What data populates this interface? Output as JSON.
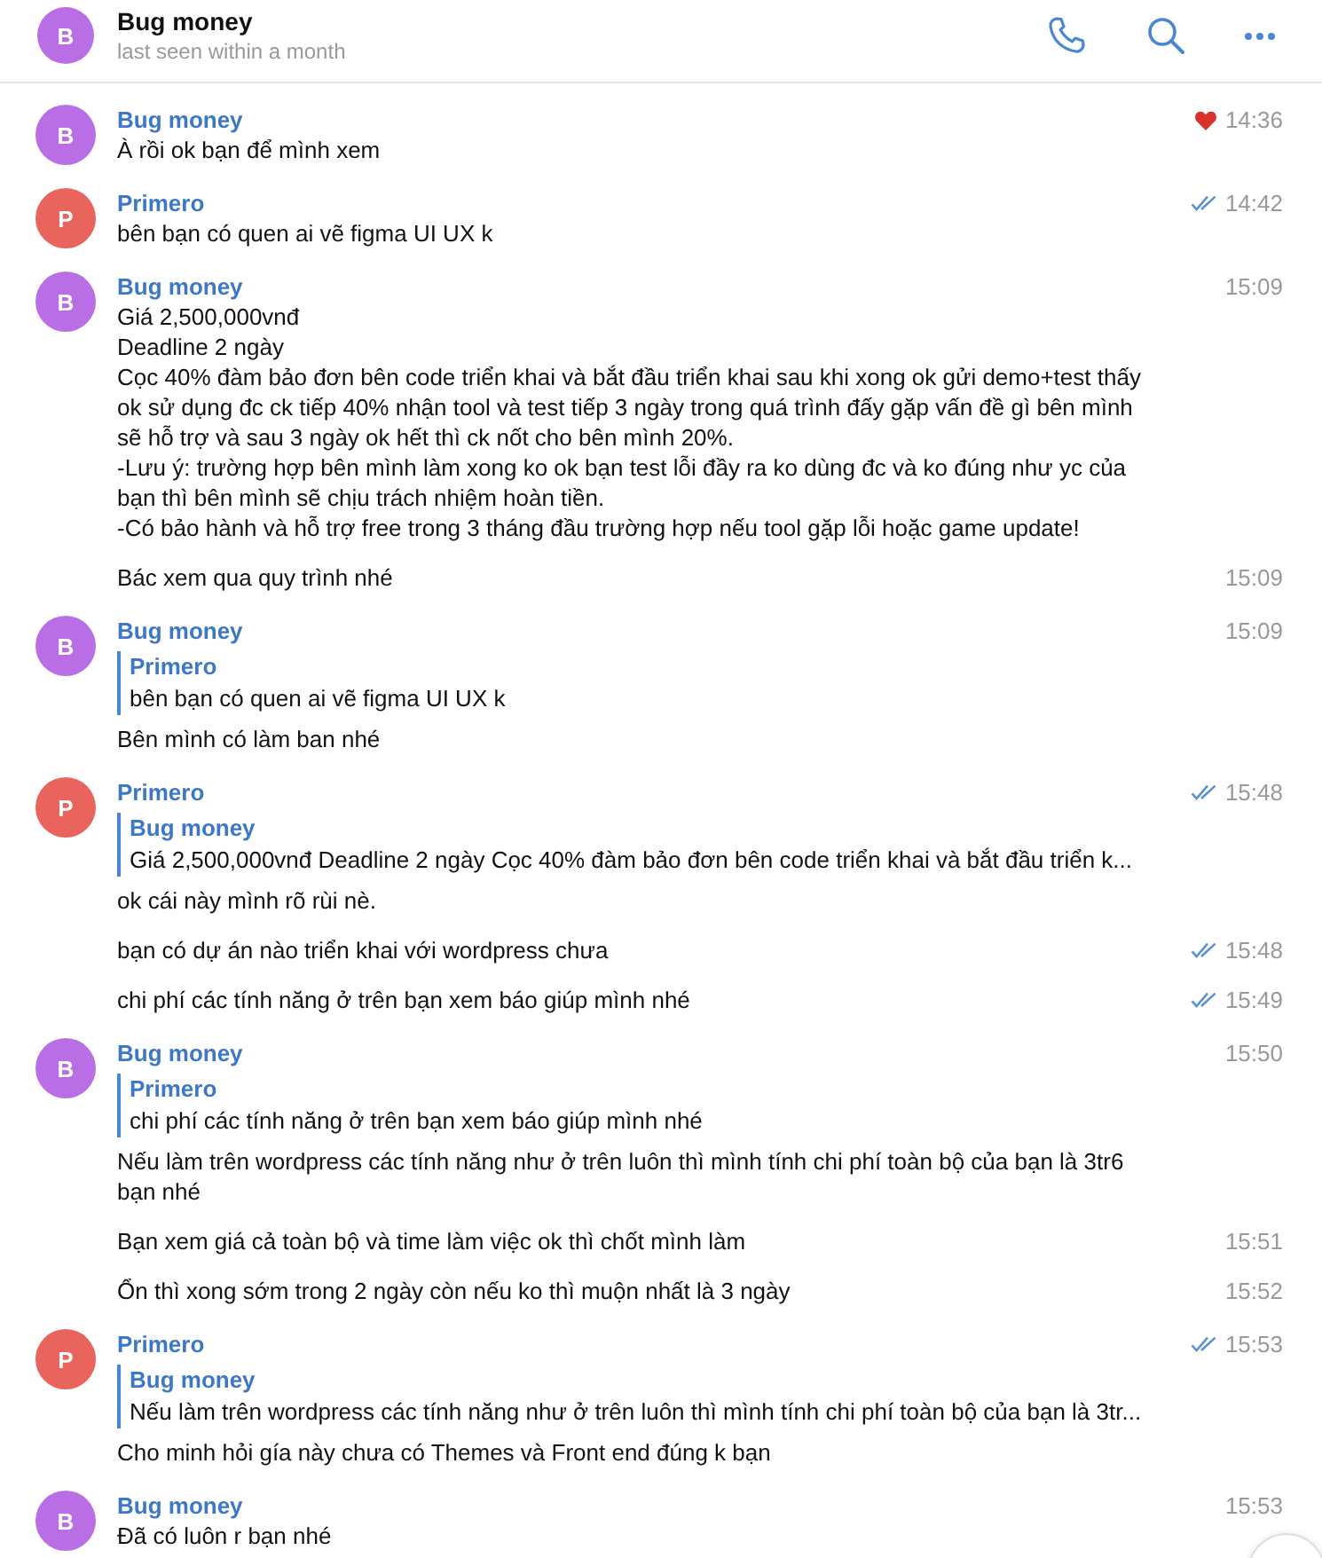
{
  "header": {
    "avatar": {
      "letter": "B",
      "color": "#b96ee6"
    },
    "title": "Bug money",
    "status": "last seen within a month"
  },
  "groups": [
    {
      "sender": "Bug money",
      "avatar": {
        "letter": "B",
        "color": "#b96ee6"
      },
      "messages": [
        {
          "text": "À rồi ok bạn để mình xem",
          "time": "14:36",
          "read": false,
          "liked": true
        }
      ]
    },
    {
      "sender": "Primero",
      "avatar": {
        "letter": "P",
        "color": "#e8645c"
      },
      "messages": [
        {
          "text": "bên bạn có quen ai vẽ figma UI UX k",
          "time": "14:42",
          "read": true,
          "liked": false
        }
      ]
    },
    {
      "sender": "Bug money",
      "avatar": {
        "letter": "B",
        "color": "#b96ee6"
      },
      "messages": [
        {
          "text": "Giá 2,500,000vnđ\nDeadline 2 ngày\nCọc 40% đàm bảo đơn bên code triển khai và bắt đầu triển khai sau khi xong ok gửi demo+test thấy ok sử dụng đc ck tiếp 40% nhận tool và test tiếp 3 ngày trong quá trình đấy gặp vấn đề gì bên mình sẽ hỗ trợ và sau 3 ngày ok hết thì ck nốt cho bên mình 20%.\n-Lưu ý: trường hợp bên mình làm xong ko ok bạn test lỗi đầy ra ko dùng đc và ko đúng như yc của bạn thì bên mình sẽ chịu trách nhiệm hoàn tiền.\n-Có bảo hành và hỗ trợ free trong 3 tháng đầu trường hợp nếu tool gặp lỗi hoặc game update!",
          "time": "15:09",
          "read": false,
          "liked": false
        },
        {
          "text": "Bác xem qua quy trình nhé",
          "time": "15:09",
          "read": false,
          "liked": false
        }
      ]
    },
    {
      "sender": "Bug money",
      "avatar": {
        "letter": "B",
        "color": "#b96ee6"
      },
      "messages": [
        {
          "reply": {
            "sender": "Primero",
            "text": "bên bạn có quen ai vẽ figma UI UX k"
          },
          "text": "Bên mình có làm ban nhé",
          "time": "15:09",
          "read": false,
          "liked": false
        }
      ]
    },
    {
      "sender": "Primero",
      "avatar": {
        "letter": "P",
        "color": "#e8645c"
      },
      "messages": [
        {
          "reply": {
            "sender": "Bug money",
            "text": "Giá 2,500,000vnđ Deadline 2 ngày  Cọc 40% đàm bảo đơn bên code triển khai và bắt đầu triển k..."
          },
          "text": "ok cái này mình rõ rùi nè.",
          "time": "15:48",
          "read": true,
          "liked": false
        },
        {
          "text": "bạn có dự án nào triển khai với wordpress chưa",
          "time": "15:48",
          "read": true,
          "liked": false
        },
        {
          "text": "chi phí các tính năng ở trên bạn xem báo giúp mình nhé",
          "time": "15:49",
          "read": true,
          "liked": false
        }
      ]
    },
    {
      "sender": "Bug money",
      "avatar": {
        "letter": "B",
        "color": "#b96ee6"
      },
      "messages": [
        {
          "reply": {
            "sender": "Primero",
            "text": "chi phí các tính năng ở trên bạn xem báo giúp mình nhé"
          },
          "text": "Nếu làm trên wordpress các tính năng như ở trên luôn thì mình tính chi phí toàn bộ của bạn là 3tr6 bạn nhé",
          "time": "15:50",
          "read": false,
          "liked": false
        },
        {
          "text": "Bạn xem giá cả toàn bộ và time làm việc ok thì chốt mình làm",
          "time": "15:51",
          "read": false,
          "liked": false
        },
        {
          "text": "Ổn thì xong sớm trong 2 ngày còn nếu ko thì muộn nhất là 3 ngày",
          "time": "15:52",
          "read": false,
          "liked": false
        }
      ]
    },
    {
      "sender": "Primero",
      "avatar": {
        "letter": "P",
        "color": "#e8645c"
      },
      "messages": [
        {
          "reply": {
            "sender": "Bug money",
            "text": "Nếu làm trên wordpress các tính năng như ở trên luôn thì mình tính chi phí toàn bộ của bạn là 3tr..."
          },
          "text": "Cho minh hỏi gía này chưa có Themes và Front end đúng k bạn",
          "time": "15:53",
          "read": true,
          "liked": false
        }
      ]
    },
    {
      "sender": "Bug money",
      "avatar": {
        "letter": "B",
        "color": "#b96ee6"
      },
      "messages": [
        {
          "text": "Đã có luôn r bạn nhé",
          "time": "15:53",
          "read": false,
          "liked": false
        }
      ]
    }
  ]
}
